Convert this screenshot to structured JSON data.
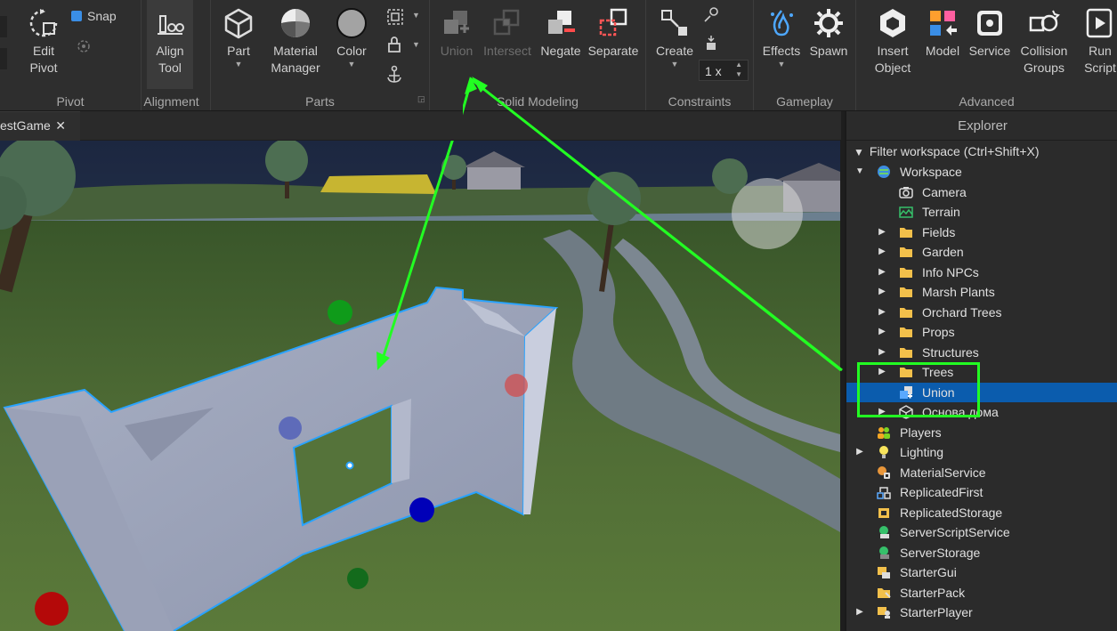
{
  "ribbon": {
    "edit_pivot": "Edit\nPivot",
    "snap": "Snap",
    "align_tool": "Align\nTool",
    "part": "Part",
    "material_manager": "Material\nManager",
    "color": "Color",
    "union": "Union",
    "intersect": "Intersect",
    "negate": "Negate",
    "separate": "Separate",
    "create": "Create",
    "scale_value": "1 x",
    "effects": "Effects",
    "spawn": "Spawn",
    "insert_object": "Insert\nObject",
    "model": "Model",
    "service": "Service",
    "collision_groups": "Collision\nGroups",
    "run_script": "Run\nScript",
    "groups": {
      "pivot": "Pivot",
      "alignment": "Alignment",
      "parts": "Parts",
      "solid_modeling": "Solid Modeling",
      "constraints": "Constraints",
      "gameplay": "Gameplay",
      "advanced": "Advanced"
    }
  },
  "tab": {
    "label": "estGame",
    "close": "✕"
  },
  "explorer": {
    "title": "Explorer",
    "filter": "Filter workspace (Ctrl+Shift+X)",
    "items": [
      {
        "label": "Workspace",
        "icon": "workspace-icon",
        "depth": 0,
        "arrow": "▼"
      },
      {
        "label": "Camera",
        "icon": "camera-icon",
        "depth": 1,
        "arrow": ""
      },
      {
        "label": "Terrain",
        "icon": "terrain-icon",
        "depth": 1,
        "arrow": ""
      },
      {
        "label": "Fields",
        "icon": "folder-icon",
        "depth": 1,
        "arrow": "▶"
      },
      {
        "label": "Garden",
        "icon": "folder-icon",
        "depth": 1,
        "arrow": "▶"
      },
      {
        "label": "Info NPCs",
        "icon": "folder-icon",
        "depth": 1,
        "arrow": "▶"
      },
      {
        "label": "Marsh Plants",
        "icon": "folder-icon",
        "depth": 1,
        "arrow": "▶"
      },
      {
        "label": "Orchard Trees",
        "icon": "folder-icon",
        "depth": 1,
        "arrow": "▶"
      },
      {
        "label": "Props",
        "icon": "folder-icon",
        "depth": 1,
        "arrow": "▶"
      },
      {
        "label": "Structures",
        "icon": "folder-icon",
        "depth": 1,
        "arrow": "▶"
      },
      {
        "label": "Trees",
        "icon": "folder-icon",
        "depth": 1,
        "arrow": "▶"
      },
      {
        "label": "Union",
        "icon": "union-icon",
        "depth": 1,
        "arrow": "",
        "selected": true
      },
      {
        "label": "Основа дома",
        "icon": "model-icon",
        "depth": 1,
        "arrow": "▶"
      },
      {
        "label": "Players",
        "icon": "players-icon",
        "depth": 0,
        "arrow": ""
      },
      {
        "label": "Lighting",
        "icon": "lighting-icon",
        "depth": 0,
        "arrow": "▶"
      },
      {
        "label": "MaterialService",
        "icon": "material-service-icon",
        "depth": 0,
        "arrow": ""
      },
      {
        "label": "ReplicatedFirst",
        "icon": "replicated-first-icon",
        "depth": 0,
        "arrow": ""
      },
      {
        "label": "ReplicatedStorage",
        "icon": "replicated-storage-icon",
        "depth": 0,
        "arrow": ""
      },
      {
        "label": "ServerScriptService",
        "icon": "server-script-service-icon",
        "depth": 0,
        "arrow": ""
      },
      {
        "label": "ServerStorage",
        "icon": "server-storage-icon",
        "depth": 0,
        "arrow": ""
      },
      {
        "label": "StarterGui",
        "icon": "starter-gui-icon",
        "depth": 0,
        "arrow": ""
      },
      {
        "label": "StarterPack",
        "icon": "starter-pack-icon",
        "depth": 0,
        "arrow": ""
      },
      {
        "label": "StarterPlayer",
        "icon": "starter-player-icon",
        "depth": 0,
        "arrow": "▶"
      }
    ]
  },
  "colors": {
    "annotation": "#22ff22",
    "selection": "#0b5cad",
    "folder": "#f2c04b",
    "ribbon_bg": "#2e2e2e"
  }
}
